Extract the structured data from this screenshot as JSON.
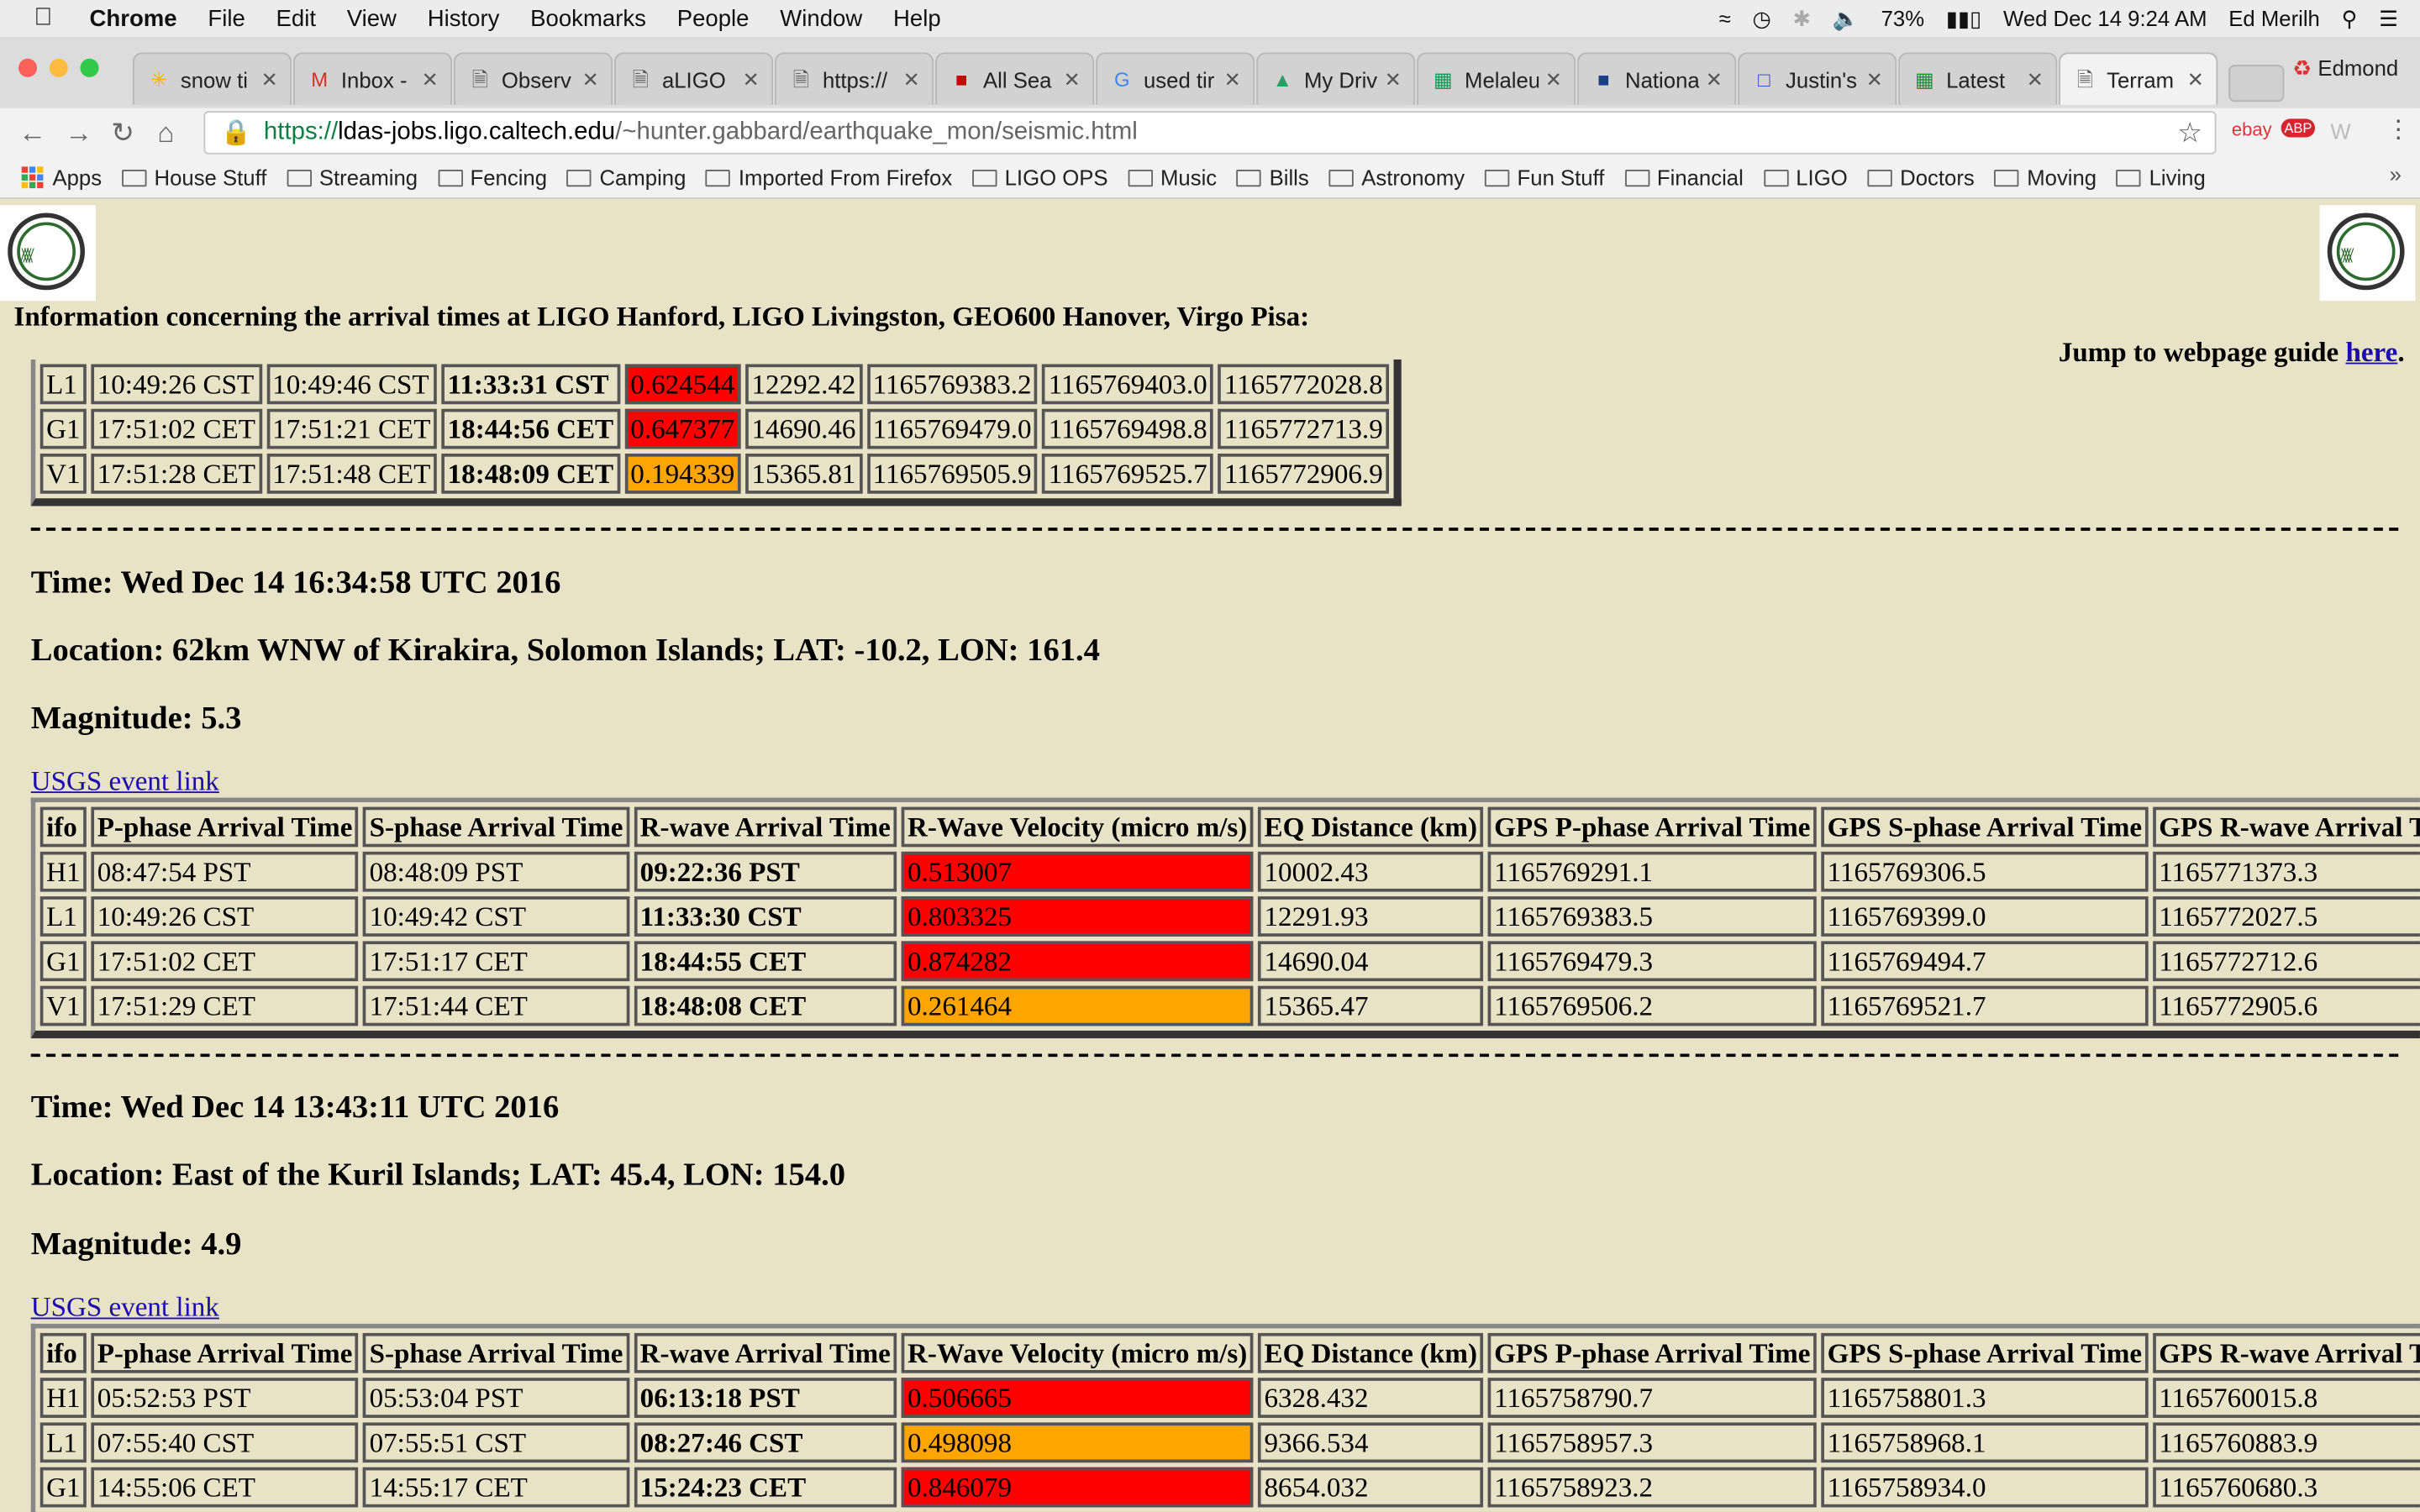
{
  "menubar": {
    "app": "Chrome",
    "items": [
      "File",
      "Edit",
      "View",
      "History",
      "Bookmarks",
      "People",
      "Window",
      "Help"
    ],
    "battery": "73%",
    "datetime": "Wed Dec 14  9:24 AM",
    "user": "Ed Merilh"
  },
  "tabs": [
    {
      "title": "snow ti",
      "icon": "walmart-icon"
    },
    {
      "title": "Inbox -",
      "icon": "gmail-icon"
    },
    {
      "title": "Observ",
      "icon": "page-icon"
    },
    {
      "title": "aLIGO",
      "icon": "page-icon"
    },
    {
      "title": "https://",
      "icon": "page-icon"
    },
    {
      "title": "All Sea",
      "icon": "jrl-icon"
    },
    {
      "title": "used tir",
      "icon": "google-icon"
    },
    {
      "title": "My Driv",
      "icon": "drive-icon"
    },
    {
      "title": "Melaleu",
      "icon": "sheets-icon"
    },
    {
      "title": "Nationa",
      "icon": "weather-icon"
    },
    {
      "title": "Justin's",
      "icon": "blue-icon"
    },
    {
      "title": "Latest",
      "icon": "green-icon"
    },
    {
      "title": "Terram",
      "icon": "page-icon",
      "active": true
    }
  ],
  "profile_name": "Edmond",
  "address": {
    "scheme": "https://",
    "host": "ldas-jobs.ligo.caltech.edu",
    "path": "/~hunter.gabbard/earthquake_mon/seismic.html"
  },
  "bookmarks": [
    "Apps",
    "House Stuff",
    "Streaming",
    "Fencing",
    "Camping",
    "Imported From Firefox",
    "LIGO OPS",
    "Music",
    "Bills",
    "Astronomy",
    "Fun Stuff",
    "Financial",
    "LIGO",
    "Doctors",
    "Moving",
    "Living"
  ],
  "page": {
    "info_heading": "Information concerning the arrival times at LIGO Hanford, LIGO Livingston, GEO600 Hanover, Virgo Pisa:",
    "jump_text": "Jump to webpage guide",
    "jump_link": "here",
    "usgs_link": "USGS event link",
    "columns": [
      "ifo",
      "P-phase Arrival Time",
      "S-phase Arrival Time",
      "R-wave Arrival Time",
      "R-Wave Velocity (micro m/s)",
      "EQ Distance (km)",
      "GPS P-phase Arrival Time",
      "GPS S-phase Arrival Time",
      "GPS R-wave Arrival Time"
    ],
    "partial_rows": [
      [
        "L1",
        "10:49:26 CST",
        "10:49:46 CST",
        "11:33:31 CST",
        "0.624544",
        "12292.42",
        "1165769383.2",
        "1165769403.0",
        "1165772028.8"
      ],
      [
        "G1",
        "17:51:02 CET",
        "17:51:21 CET",
        "18:44:56 CET",
        "0.647377",
        "14690.46",
        "1165769479.0",
        "1165769498.8",
        "1165772713.9"
      ],
      [
        "V1",
        "17:51:28 CET",
        "17:51:48 CET",
        "18:48:09 CET",
        "0.194339",
        "15365.81",
        "1165769505.9",
        "1165769525.7",
        "1165772906.9"
      ]
    ],
    "partial_colors": [
      "red",
      "red",
      "orange"
    ],
    "events": [
      {
        "time": "Time: Wed Dec 14 16:34:58 UTC 2016",
        "location": "Location: 62km WNW of Kirakira, Solomon Islands; LAT: -10.2, LON: 161.4",
        "magnitude": "Magnitude: 5.3",
        "rows": [
          [
            "H1",
            "08:47:54 PST",
            "08:48:09 PST",
            "09:22:36 PST",
            "0.513007",
            "10002.43",
            "1165769291.1",
            "1165769306.5",
            "1165771373.3"
          ],
          [
            "L1",
            "10:49:26 CST",
            "10:49:42 CST",
            "11:33:30 CST",
            "0.803325",
            "12291.93",
            "1165769383.5",
            "1165769399.0",
            "1165772027.5"
          ],
          [
            "G1",
            "17:51:02 CET",
            "17:51:17 CET",
            "18:44:55 CET",
            "0.874282",
            "14690.04",
            "1165769479.3",
            "1165769494.7",
            "1165772712.6"
          ],
          [
            "V1",
            "17:51:29 CET",
            "17:51:44 CET",
            "18:48:08 CET",
            "0.261464",
            "15365.47",
            "1165769506.2",
            "1165769521.7",
            "1165772905.6"
          ]
        ],
        "colors": [
          "red",
          "red",
          "red",
          "orange"
        ]
      },
      {
        "time": "Time: Wed Dec 14 13:43:11 UTC 2016",
        "location": "Location: East of the Kuril Islands; LAT: 45.4, LON: 154.0",
        "magnitude": "Magnitude: 4.9",
        "rows": [
          [
            "H1",
            "05:52:53 PST",
            "05:53:04 PST",
            "06:13:18 PST",
            "0.506665",
            "6328.432",
            "1165758790.7",
            "1165758801.3",
            "1165760015.8"
          ],
          [
            "L1",
            "07:55:40 CST",
            "07:55:51 CST",
            "08:27:46 CST",
            "0.498098",
            "9366.534",
            "1165758957.3",
            "1165758968.1",
            "1165760883.9"
          ],
          [
            "G1",
            "14:55:06 CET",
            "14:55:17 CET",
            "15:24:23 CET",
            "0.846079",
            "8654.032",
            "1165758923.2",
            "1165758934.0",
            "1165760680.3"
          ]
        ],
        "colors": [
          "red",
          "orange",
          "red"
        ]
      }
    ]
  },
  "status_colors": {
    "red": "#ff0000",
    "orange": "#ffa500"
  }
}
